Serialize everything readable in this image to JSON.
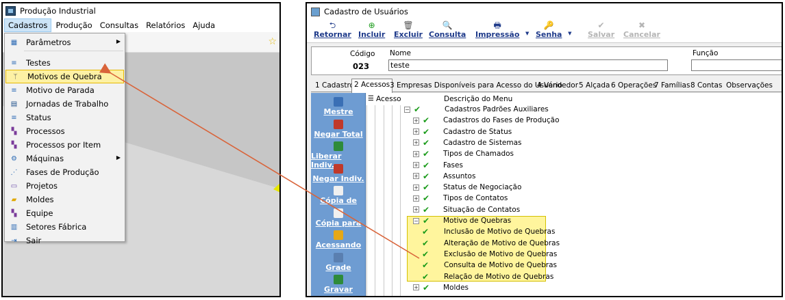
{
  "left_window": {
    "title": "Produção Industrial",
    "menubar": [
      "Cadastros",
      "Produção",
      "Consultas",
      "Relatórios",
      "Ajuda"
    ],
    "dropdown": [
      {
        "label": "Parâmetros",
        "icon": "grid-icon",
        "submenu": true
      },
      {
        "label": "Testes",
        "icon": "list-icon"
      },
      {
        "label": "Motivos de Quebra",
        "icon": "branch-icon",
        "highlighted": true
      },
      {
        "label": "Motivo de Parada",
        "icon": "list-icon"
      },
      {
        "label": "Jornadas de Trabalho",
        "icon": "book-icon"
      },
      {
        "label": "Status",
        "icon": "list-icon"
      },
      {
        "label": "Processos",
        "icon": "blocks-icon"
      },
      {
        "label": "Processos por Item",
        "icon": "blocks-icon"
      },
      {
        "label": "Máquinas",
        "icon": "gears-icon",
        "submenu": true
      },
      {
        "label": "Fases de Produção",
        "icon": "flow-icon"
      },
      {
        "label": "Projetos",
        "icon": "document-icon"
      },
      {
        "label": "Moldes",
        "icon": "folder-icon"
      },
      {
        "label": "Equipe",
        "icon": "blocks-icon"
      },
      {
        "label": "Setores Fábrica",
        "icon": "sections-icon"
      },
      {
        "label": "Sair",
        "icon": "exit-icon"
      }
    ]
  },
  "right_window": {
    "title": "Cadastro de Usuários",
    "toolbar": [
      {
        "label": "Retornar",
        "icon": "return-icon"
      },
      {
        "label": "Incluir",
        "icon": "add-icon"
      },
      {
        "label": "Excluir",
        "icon": "trash-icon"
      },
      {
        "label": "Consulta",
        "icon": "search-icon"
      },
      {
        "label": "Impressão",
        "icon": "printer-icon"
      },
      {
        "label": "Senha",
        "icon": "key-icon"
      },
      {
        "label": "Salvar",
        "icon": "save-icon"
      },
      {
        "label": "Cancelar",
        "icon": "cancel-icon"
      }
    ],
    "form": {
      "codigo_label": "Código",
      "codigo_value": "023",
      "nome_label": "Nome",
      "nome_value": "teste",
      "funcao_label": "Função",
      "funcao_value": ""
    },
    "tabs": [
      "1 Cadastro",
      "2 Acessos",
      "3 Empresas Disponíveis para Acesso do Usuário",
      "4 Vendedor",
      "5 Alçada",
      "6 Operações",
      "7 Famílias",
      "8 Contas",
      "Observações"
    ],
    "side_buttons": [
      "Mestre",
      "Negar Total",
      "Liberar Indiv.",
      "Negar Indiv.",
      "Cópia de",
      "Cópia para",
      "Acessando",
      "Grade",
      "Gravar"
    ],
    "tree_header": {
      "acesso": "Acesso",
      "descricao": "Descrição do Menu"
    },
    "tree": [
      {
        "label": "Cadastros Padrões Auxiliares",
        "level": 0,
        "exp": "−"
      },
      {
        "label": "Cadastros do Fases de Produção",
        "level": 1,
        "exp": "+"
      },
      {
        "label": "Cadastro de Status",
        "level": 1,
        "exp": "+"
      },
      {
        "label": "Cadastro de Sistemas",
        "level": 1,
        "exp": "+"
      },
      {
        "label": "Tipos de Chamados",
        "level": 1,
        "exp": "+"
      },
      {
        "label": "Fases",
        "level": 1,
        "exp": "+"
      },
      {
        "label": "Assuntos",
        "level": 1,
        "exp": "+"
      },
      {
        "label": "Status de Negociação",
        "level": 1,
        "exp": "+"
      },
      {
        "label": "Tipos de Contatos",
        "level": 1,
        "exp": "+"
      },
      {
        "label": "Situação de Contatos",
        "level": 1,
        "exp": "+"
      },
      {
        "label": "Motivo de Quebras",
        "level": 1,
        "exp": "−"
      },
      {
        "label": "Inclusão de Motivo de Quebras",
        "level": 2,
        "exp": ""
      },
      {
        "label": "Alteração de Motivo de Quebras",
        "level": 2,
        "exp": ""
      },
      {
        "label": "Exclusão de Motivo de Quebras",
        "level": 2,
        "exp": ""
      },
      {
        "label": "Consulta de Motivo de Quebras",
        "level": 2,
        "exp": ""
      },
      {
        "label": "Relação de Motivo de Quebras",
        "level": 2,
        "exp": ""
      },
      {
        "label": "Moldes",
        "level": 1,
        "exp": "+"
      }
    ]
  }
}
